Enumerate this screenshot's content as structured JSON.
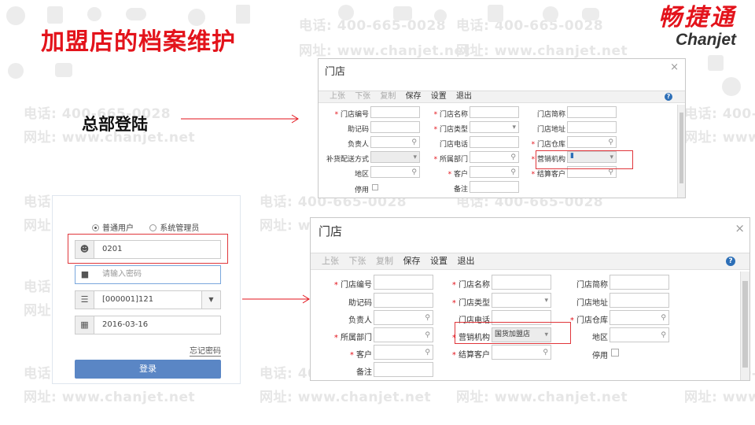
{
  "slide": {
    "title": "加盟店的档案维护",
    "hq_label": "总部登陆",
    "watermark": {
      "phone": "电话: 400-665-0028",
      "site": "网址: www.chanjet.net"
    },
    "colors": {
      "accent": "#e3131b",
      "button": "#5a86c5",
      "highlight_border": "#e0363b"
    }
  },
  "logo": {
    "chinese": "畅捷通",
    "english": "Chanjet"
  },
  "login": {
    "radio_user": "普通用户",
    "radio_admin": "系统管理员",
    "username": "0201",
    "password_placeholder": "请输入密码",
    "account": "[000001]121",
    "date": "2016-03-16",
    "forgot": "忘记密码",
    "submit": "登录"
  },
  "form": {
    "title": "门店",
    "close": "×",
    "toolbar": [
      "上张",
      "下张",
      "复制",
      "保存",
      "设置",
      "退出"
    ],
    "help": "?",
    "labels": {
      "store_code": "门店编号",
      "mnemonic": "助记码",
      "manager": "负责人",
      "replenish": "补货配送方式",
      "region": "地区",
      "disabled": "停用",
      "store_name": "门店名称",
      "store_type": "门店类型",
      "store_phone": "门店电话",
      "department": "所属部门",
      "customer": "客户",
      "remark": "备注",
      "short_name": "门店简称",
      "address": "门店地址",
      "warehouse": "门店仓库",
      "sales_org": "营销机构",
      "settle_customer": "结算客户"
    },
    "sales_org_value": "国货加盟店",
    "sales_org_value_small": "▮"
  },
  "icons": {
    "search": "search-icon",
    "dropdown": "chevron-down-icon",
    "user": "user-icon",
    "lock": "lock-icon",
    "list": "list-icon",
    "calendar": "calendar-icon"
  }
}
